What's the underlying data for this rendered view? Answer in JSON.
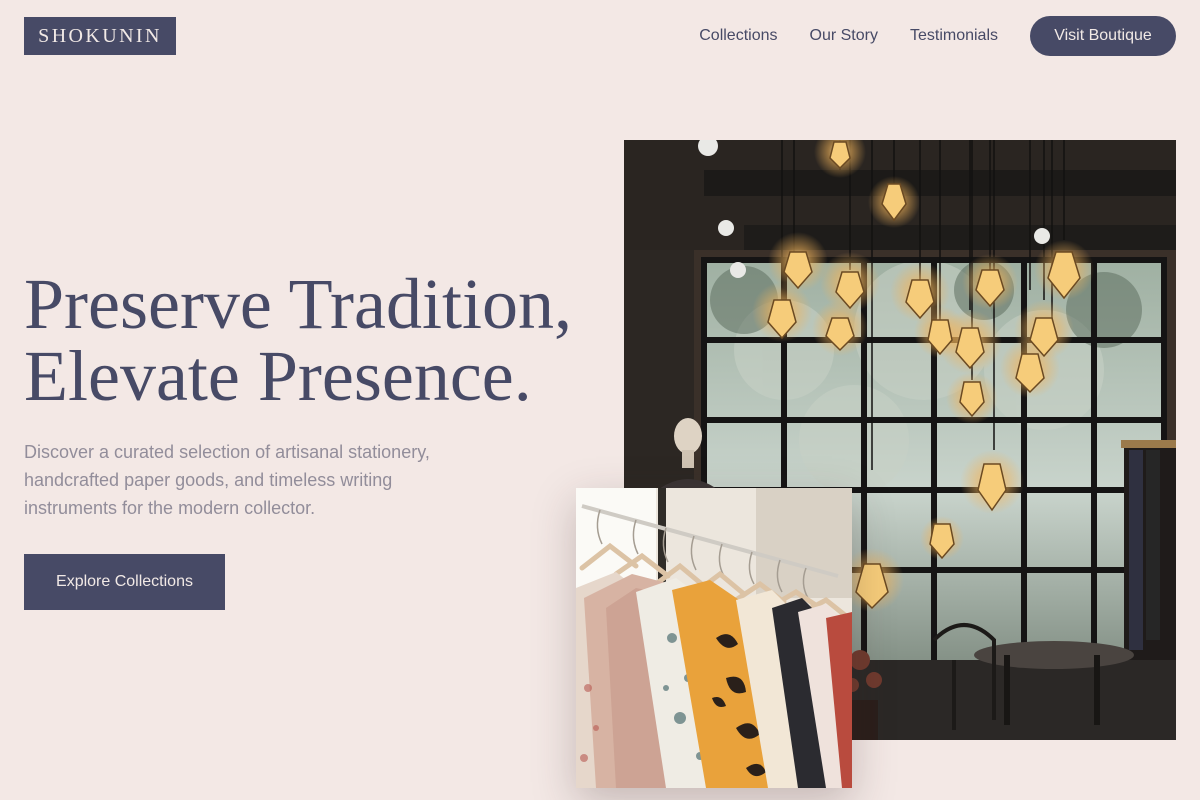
{
  "header": {
    "logo": "SHOKUNIN",
    "nav": [
      {
        "label": "Collections"
      },
      {
        "label": "Our Story"
      },
      {
        "label": "Testimonials"
      }
    ],
    "cta_label": "Visit Boutique"
  },
  "hero": {
    "title_line1": "Preserve Tradition,",
    "title_line2": "Elevate Presence.",
    "description": "Discover a curated selection of artisanal stationery, handcrafted paper goods, and timeless writing instruments for the modern collector.",
    "cta_label": "Explore Collections"
  },
  "colors": {
    "background": "#f3e8e5",
    "primary": "#474a66",
    "muted_text": "#928d9a",
    "button_text": "#f1e9e6"
  }
}
